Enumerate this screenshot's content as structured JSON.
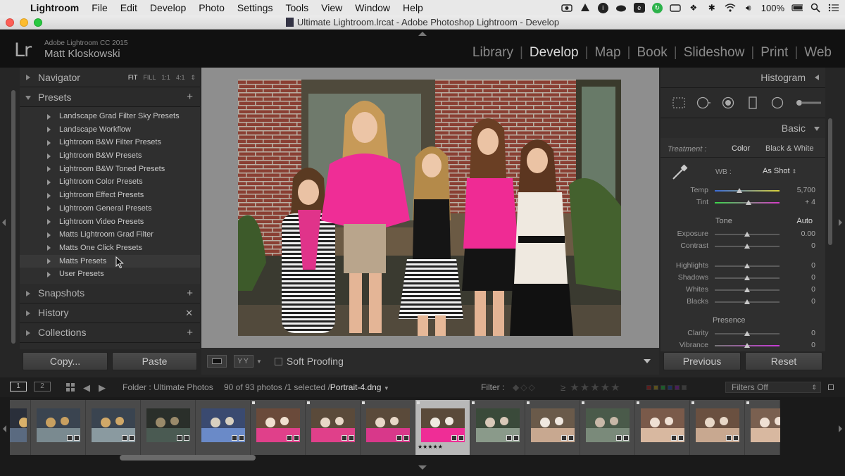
{
  "menubar": {
    "items": [
      "Lightroom",
      "File",
      "Edit",
      "Develop",
      "Photo",
      "Settings",
      "Tools",
      "View",
      "Window",
      "Help"
    ],
    "status": {
      "battery": "100%"
    },
    "colors": {
      "bar": "#e8e8e8"
    }
  },
  "window": {
    "title": "Ultimate Lightroom.lrcat - Adobe Photoshop Lightroom - Develop"
  },
  "identity": {
    "logo": "Lr",
    "app": "Adobe Lightroom CC 2015",
    "user": "Matt Kloskowski"
  },
  "modules": {
    "items": [
      "Library",
      "Develop",
      "Map",
      "Book",
      "Slideshow",
      "Print",
      "Web"
    ],
    "active": "Develop"
  },
  "left_panel": {
    "navigator": {
      "title": "Navigator",
      "zoom": [
        "FIT",
        "FILL",
        "1:1",
        "4:1"
      ]
    },
    "presets": {
      "title": "Presets",
      "items": [
        "Landscape Grad Filter Sky Presets",
        "Landscape Workflow",
        "Lightroom B&W Filter Presets",
        "Lightroom B&W Presets",
        "Lightroom B&W Toned Presets",
        "Lightroom Color Presets",
        "Lightroom Effect Presets",
        "Lightroom General Presets",
        "Lightroom Video Presets",
        "Matts Lightroom Grad Filter",
        "Matts One Click Presets",
        "Matts Presets",
        "User Presets"
      ],
      "hovered": "Matts Presets"
    },
    "snapshots": {
      "title": "Snapshots"
    },
    "history": {
      "title": "History"
    },
    "collections": {
      "title": "Collections"
    },
    "buttons": {
      "copy": "Copy...",
      "paste": "Paste"
    }
  },
  "toolbar": {
    "soft_proofing": "Soft Proofing"
  },
  "right_panel": {
    "histogram": {
      "title": "Histogram"
    },
    "basic": {
      "title": "Basic",
      "treatment_label": "Treatment :",
      "treatment_color": "Color",
      "treatment_bw": "Black & White",
      "wb_label": "WB :",
      "wb_value": "As Shot",
      "temp": {
        "label": "Temp",
        "value": "5,700",
        "position": 0.38
      },
      "tint": {
        "label": "Tint",
        "value": "+ 4",
        "position": 0.52
      },
      "tone_label": "Tone",
      "auto_label": "Auto",
      "tone": [
        {
          "label": "Exposure",
          "value": "0.00",
          "position": 0.5
        },
        {
          "label": "Contrast",
          "value": "0",
          "position": 0.5
        }
      ],
      "tone2": [
        {
          "label": "Highlights",
          "value": "0",
          "position": 0.5
        },
        {
          "label": "Shadows",
          "value": "0",
          "position": 0.5
        },
        {
          "label": "Whites",
          "value": "0",
          "position": 0.5
        },
        {
          "label": "Blacks",
          "value": "0",
          "position": 0.5
        }
      ],
      "presence_label": "Presence",
      "presence": [
        {
          "label": "Clarity",
          "value": "0",
          "position": 0.5
        },
        {
          "label": "Vibrance",
          "value": "0",
          "position": 0.5
        }
      ]
    },
    "buttons": {
      "previous": "Previous",
      "reset": "Reset"
    }
  },
  "filmstrip_bar": {
    "monitor1": "1",
    "monitor2": "2",
    "folder": "Folder : Ultimate Photos",
    "count": "90 of 93 photos /1 selected /",
    "filename": "Portrait-4.dng",
    "filter_label": "Filter :",
    "filters_off": "Filters Off"
  },
  "filmstrip": {
    "selected_index": 8,
    "selected_rating": "★★★★★",
    "count": 15
  }
}
